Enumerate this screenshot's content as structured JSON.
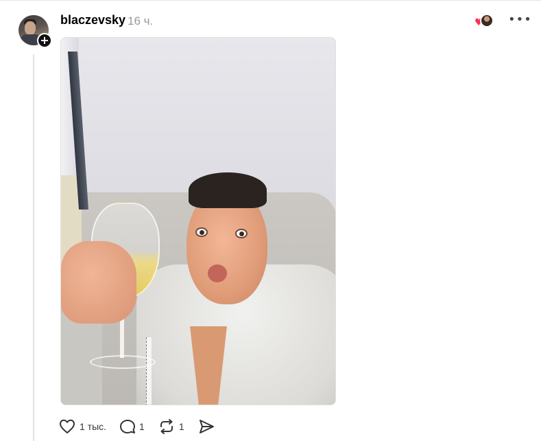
{
  "post": {
    "username": "blaczevsky",
    "time": "16 ч.",
    "follow_symbol": "+",
    "more_symbol": "•••"
  },
  "actions": {
    "like_count": "1 тыс.",
    "reply_count": "1",
    "repost_count": "1"
  },
  "icons": {
    "liker_heart": "♥",
    "like": "heart-outline-icon",
    "reply": "speech-bubble-icon",
    "repost": "repost-arrows-icon",
    "share": "send-arrow-icon"
  },
  "colors": {
    "like_heart": "#ff2d55",
    "muted_text": "#999999",
    "thread_line": "#e0e0e0"
  }
}
